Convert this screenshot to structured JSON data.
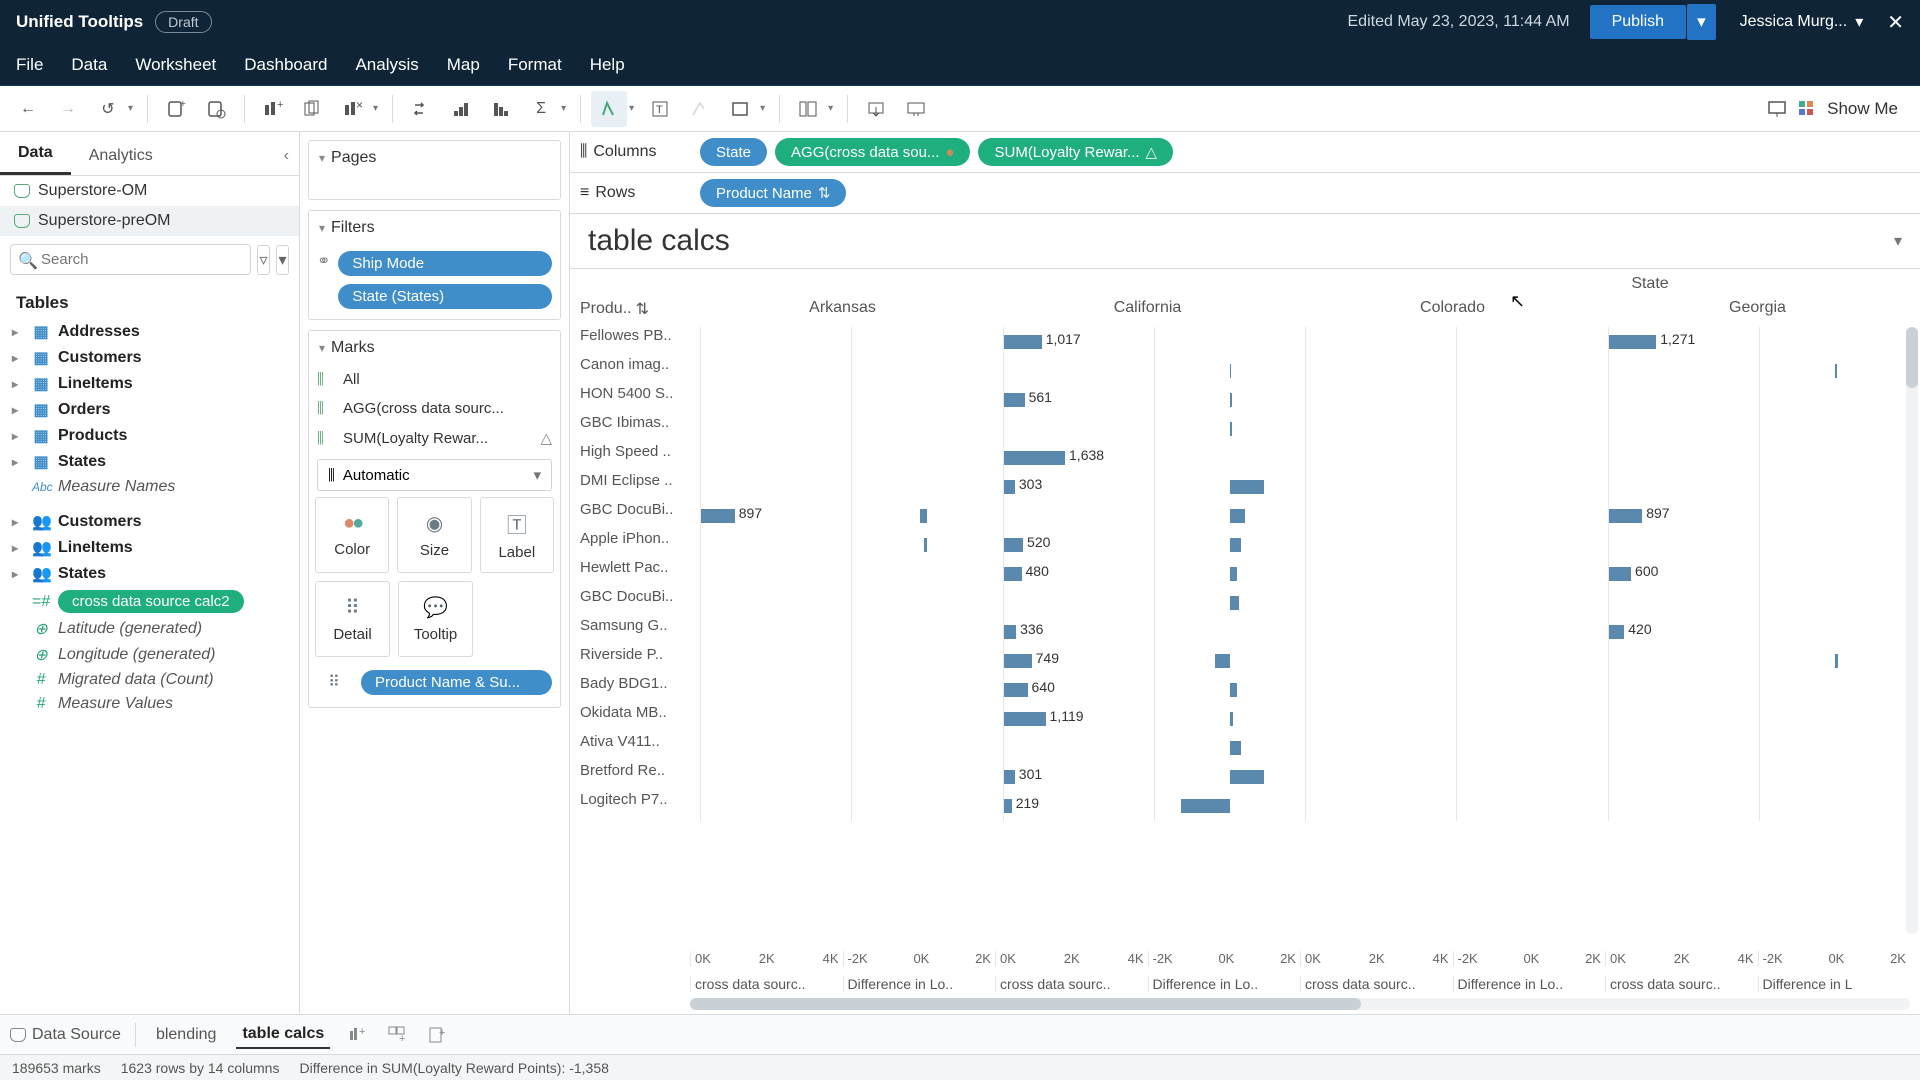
{
  "title_bar": {
    "doc_title": "Unified Tooltips",
    "draft": "Draft",
    "edited": "Edited May 23, 2023, 11:44 AM",
    "publish": "Publish",
    "user": "Jessica Murg..."
  },
  "menu": [
    "File",
    "Data",
    "Worksheet",
    "Dashboard",
    "Analysis",
    "Map",
    "Format",
    "Help"
  ],
  "show_me": "Show Me",
  "data_panel": {
    "tabs": [
      "Data",
      "Analytics"
    ],
    "sources": [
      "Superstore-OM",
      "Superstore-preOM"
    ],
    "search_placeholder": "Search",
    "tables_label": "Tables",
    "tree1": [
      "Addresses",
      "Customers",
      "LineItems",
      "Orders",
      "Products",
      "States"
    ],
    "measure_names": "Measure Names",
    "tree2": [
      "Customers",
      "LineItems",
      "States"
    ],
    "calc_pill": "cross data source calc2",
    "generated": [
      "Latitude (generated)",
      "Longitude (generated)",
      "Migrated data (Count)",
      "Measure Values"
    ]
  },
  "shelves": {
    "pages": "Pages",
    "filters": "Filters",
    "filter_pills": [
      "Ship Mode",
      "State (States)"
    ],
    "marks": "Marks",
    "mark_all": "All",
    "mark_agg": "AGG(cross data sourc...",
    "mark_sum": "SUM(Loyalty Rewar...",
    "mark_type": "Automatic",
    "cells": [
      "Color",
      "Size",
      "Label"
    ],
    "detail": "Detail",
    "tooltip": "Tooltip",
    "detail_pill": "Product Name & Su..."
  },
  "columns_label": "Columns",
  "rows_label": "Rows",
  "column_pills": [
    {
      "label": "State",
      "color": "blue"
    },
    {
      "label": "AGG(cross data sou...",
      "color": "green",
      "warn": true
    },
    {
      "label": "SUM(Loyalty Rewar...",
      "color": "green",
      "tri": true
    }
  ],
  "row_pills": [
    {
      "label": "Product Name",
      "color": "blue",
      "sort": true
    }
  ],
  "viz_title": "table calcs",
  "state_header": "State",
  "states": [
    "Arkansas",
    "California",
    "Colorado",
    "Georgia"
  ],
  "product_header": "Produ..",
  "axis_ticks_pos": [
    "0K",
    "2K",
    "4K"
  ],
  "axis_ticks_neg": [
    "-2K",
    "0K",
    "2K"
  ],
  "measure_labels": [
    "cross data sourc..",
    "Difference in Lo..",
    "cross data sourc..",
    "Difference in Lo..",
    "cross data sourc..",
    "Difference in Lo..",
    "cross data sourc..",
    "Difference in L"
  ],
  "chart_data": {
    "type": "bar",
    "products": [
      {
        "name": "Fellowes PB..",
        "vals": [
          null,
          1017,
          null,
          1271
        ]
      },
      {
        "name": "Canon imag..",
        "vals": [
          null,
          null,
          null,
          null
        ],
        "diff": [
          null,
          40,
          null,
          60
        ]
      },
      {
        "name": "HON 5400 S..",
        "vals": [
          null,
          561,
          null,
          null
        ],
        "diff": [
          null,
          60,
          null,
          null
        ]
      },
      {
        "name": "GBC Ibimas..",
        "vals": [
          null,
          null,
          null,
          null
        ],
        "diff": [
          null,
          50,
          null,
          null
        ]
      },
      {
        "name": "High Speed ..",
        "vals": [
          null,
          1638,
          null,
          null
        ],
        "diff": [
          null,
          null,
          null,
          null
        ]
      },
      {
        "name": "DMI Eclipse ..",
        "vals": [
          null,
          303,
          null,
          null
        ],
        "diff": [
          null,
          900,
          null,
          null
        ]
      },
      {
        "name": "GBC DocuBi..",
        "vals": [
          897,
          null,
          null,
          897
        ],
        "diff": [
          -200,
          400,
          null,
          null
        ]
      },
      {
        "name": "Apple iPhon..",
        "vals": [
          null,
          520,
          null,
          null
        ],
        "diff": [
          -100,
          300,
          null,
          null
        ]
      },
      {
        "name": "Hewlett Pac..",
        "vals": [
          null,
          480,
          null,
          600
        ],
        "diff": [
          null,
          200,
          null,
          null
        ]
      },
      {
        "name": "GBC DocuBi..",
        "vals": [
          null,
          null,
          null,
          null
        ],
        "diff": [
          null,
          250,
          null,
          null
        ]
      },
      {
        "name": "Samsung G..",
        "vals": [
          null,
          336,
          null,
          420
        ],
        "diff": [
          null,
          null,
          null,
          null
        ]
      },
      {
        "name": "Riverside P..",
        "vals": [
          null,
          749,
          null,
          null
        ],
        "diff": [
          null,
          -400,
          null,
          80
        ]
      },
      {
        "name": "Bady BDG1..",
        "vals": [
          null,
          640,
          null,
          null
        ],
        "diff": [
          null,
          200,
          null,
          null
        ]
      },
      {
        "name": "Okidata MB..",
        "vals": [
          null,
          1119,
          null,
          null
        ],
        "diff": [
          null,
          80,
          null,
          null
        ]
      },
      {
        "name": "Ativa V411..",
        "vals": [
          null,
          null,
          null,
          null
        ],
        "diff": [
          null,
          300,
          null,
          null
        ]
      },
      {
        "name": "Bretford Re..",
        "vals": [
          null,
          301,
          null,
          null
        ],
        "diff": [
          null,
          900,
          null,
          null
        ]
      },
      {
        "name": "Logitech P7..",
        "vals": [
          null,
          219,
          null,
          null
        ],
        "diff": [
          null,
          -1300,
          null,
          null
        ]
      }
    ],
    "x_range_pos": [
      0,
      4000
    ],
    "x_range_neg": [
      -2000,
      2000
    ]
  },
  "sheet_tabs": {
    "data_source": "Data Source",
    "tabs": [
      "blending",
      "table calcs"
    ]
  },
  "status": {
    "marks": "189653 marks",
    "dims": "1623 rows by 14 columns",
    "val": "Difference in SUM(Loyalty Reward Points): -1,358"
  }
}
